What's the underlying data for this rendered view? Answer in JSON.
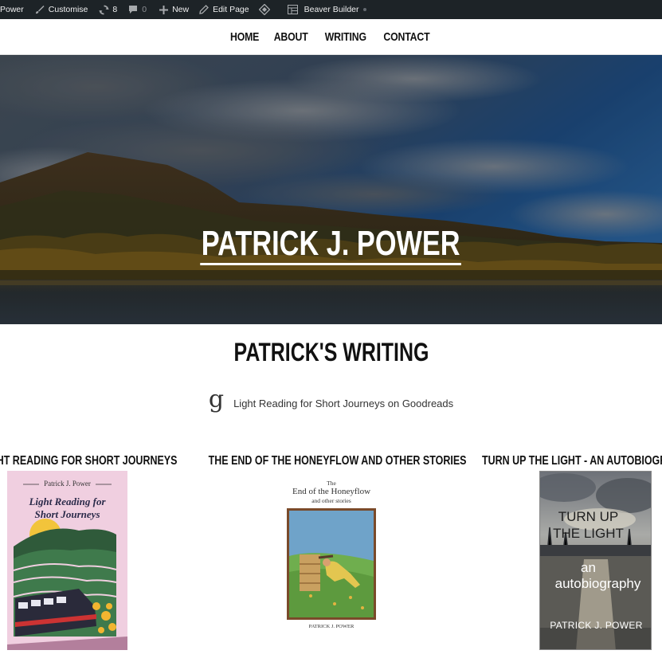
{
  "admin_bar": {
    "site": "Power",
    "customise": "Customise",
    "updates": "8",
    "comments": "0",
    "new": "New",
    "edit_page": "Edit Page",
    "builder": "Beaver Builder"
  },
  "nav": {
    "items": [
      "HOME",
      "ABOUT",
      "WRITING",
      "CONTACT"
    ]
  },
  "hero": {
    "title": "PATRICK J. POWER"
  },
  "writing": {
    "heading": "PATRICK'S WRITING",
    "goodreads_icon": "g",
    "goodreads_link": "Light Reading for Short Journeys on Goodreads"
  },
  "books": [
    {
      "title": "LIGHT READING FOR SHORT JOURNEYS",
      "cover_author": "Patrick J. Power",
      "cover_title_1": "Light Reading for",
      "cover_title_2": "Short Journeys"
    },
    {
      "title": "THE END OF THE HONEYFLOW AND OTHER STORIES",
      "cover_the": "The",
      "cover_title": "End of the Honeyflow",
      "cover_sub": "and other stories",
      "cover_author": "PATRICK J. POWER"
    },
    {
      "title": "TURN UP THE LIGHT - AN AUTOBIOGRAPHY",
      "cover_line1": "TURN UP",
      "cover_line2": "THE LIGHT",
      "cover_line3": "an",
      "cover_line4": "autobiography",
      "cover_author": "PATRICK J. POWER"
    }
  ],
  "colors": {
    "admin_bar": "#1d2327",
    "text": "#111111",
    "sky": "#2a5f95",
    "cover_pink": "#f0cfe0"
  }
}
